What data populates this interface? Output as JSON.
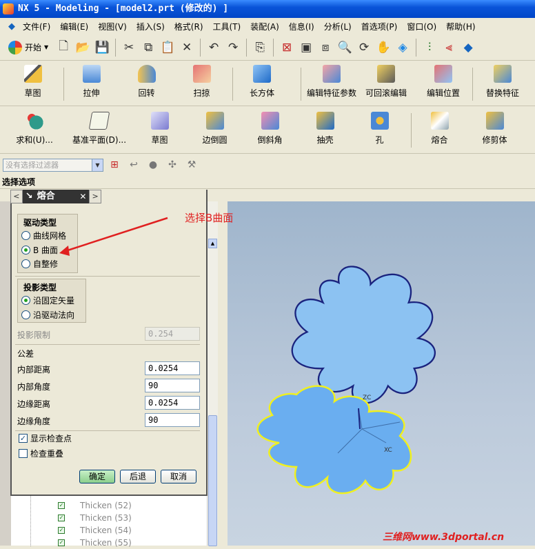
{
  "window": {
    "title": "NX 5 - Modeling - [model2.prt  (修改的) ]"
  },
  "menu": [
    "文件(F)",
    "编辑(E)",
    "视图(V)",
    "插入(S)",
    "格式(R)",
    "工具(T)",
    "装配(A)",
    "信息(I)",
    "分析(L)",
    "首选项(P)",
    "窗口(O)",
    "帮助(H)"
  ],
  "toolbar1": {
    "start_label": "开始"
  },
  "toolbar2": [
    "草图",
    "拉伸",
    "回转",
    "扫掠",
    "长方体",
    "编辑特征参数",
    "可回滚编辑",
    "编辑位置",
    "替换特征"
  ],
  "toolbar3": [
    "求和(U)...",
    "基准平面(D)...",
    "草图",
    "边倒圆",
    "倒斜角",
    "抽壳",
    "孔",
    "熔合",
    "修剪体"
  ],
  "filter": {
    "placeholder": "没有选择过滤器"
  },
  "selection_options": "选择选项",
  "dialog": {
    "title": "熔合",
    "drive_type": {
      "title": "驱动类型",
      "options": [
        "曲线网格",
        "B 曲面",
        "自整修"
      ],
      "selected": 1
    },
    "projection_type": {
      "title": "投影类型",
      "options": [
        "沿固定矢量",
        "沿驱动法向"
      ],
      "selected": 0
    },
    "projection_limit": {
      "label": "投影限制",
      "value": "0.254"
    },
    "tolerance": {
      "title": "公差",
      "inner_distance": {
        "label": "内部距离",
        "value": "0.0254"
      },
      "inner_angle": {
        "label": "内部角度",
        "value": "90"
      },
      "edge_distance": {
        "label": "边缘距离",
        "value": "0.0254"
      },
      "edge_angle": {
        "label": "边缘角度",
        "value": "90"
      }
    },
    "show_checkpoints": {
      "label": "显示检查点",
      "checked": true
    },
    "check_overlap": {
      "label": "检查重叠",
      "checked": false
    },
    "buttons": {
      "ok": "确定",
      "back": "后退",
      "cancel": "取消"
    }
  },
  "tree": [
    "Thicken (52)",
    "Thicken (53)",
    "Thicken (54)",
    "Thicken (55)"
  ],
  "annotation": "选择B曲面",
  "axes": {
    "z": "ZC",
    "x": "XC"
  },
  "watermark": "三维网www.3dportal.cn",
  "colors": {
    "annotation": "#e02020",
    "surface": "#6aaef0",
    "highlight": "#f0f020",
    "outline": "#1a237e"
  }
}
